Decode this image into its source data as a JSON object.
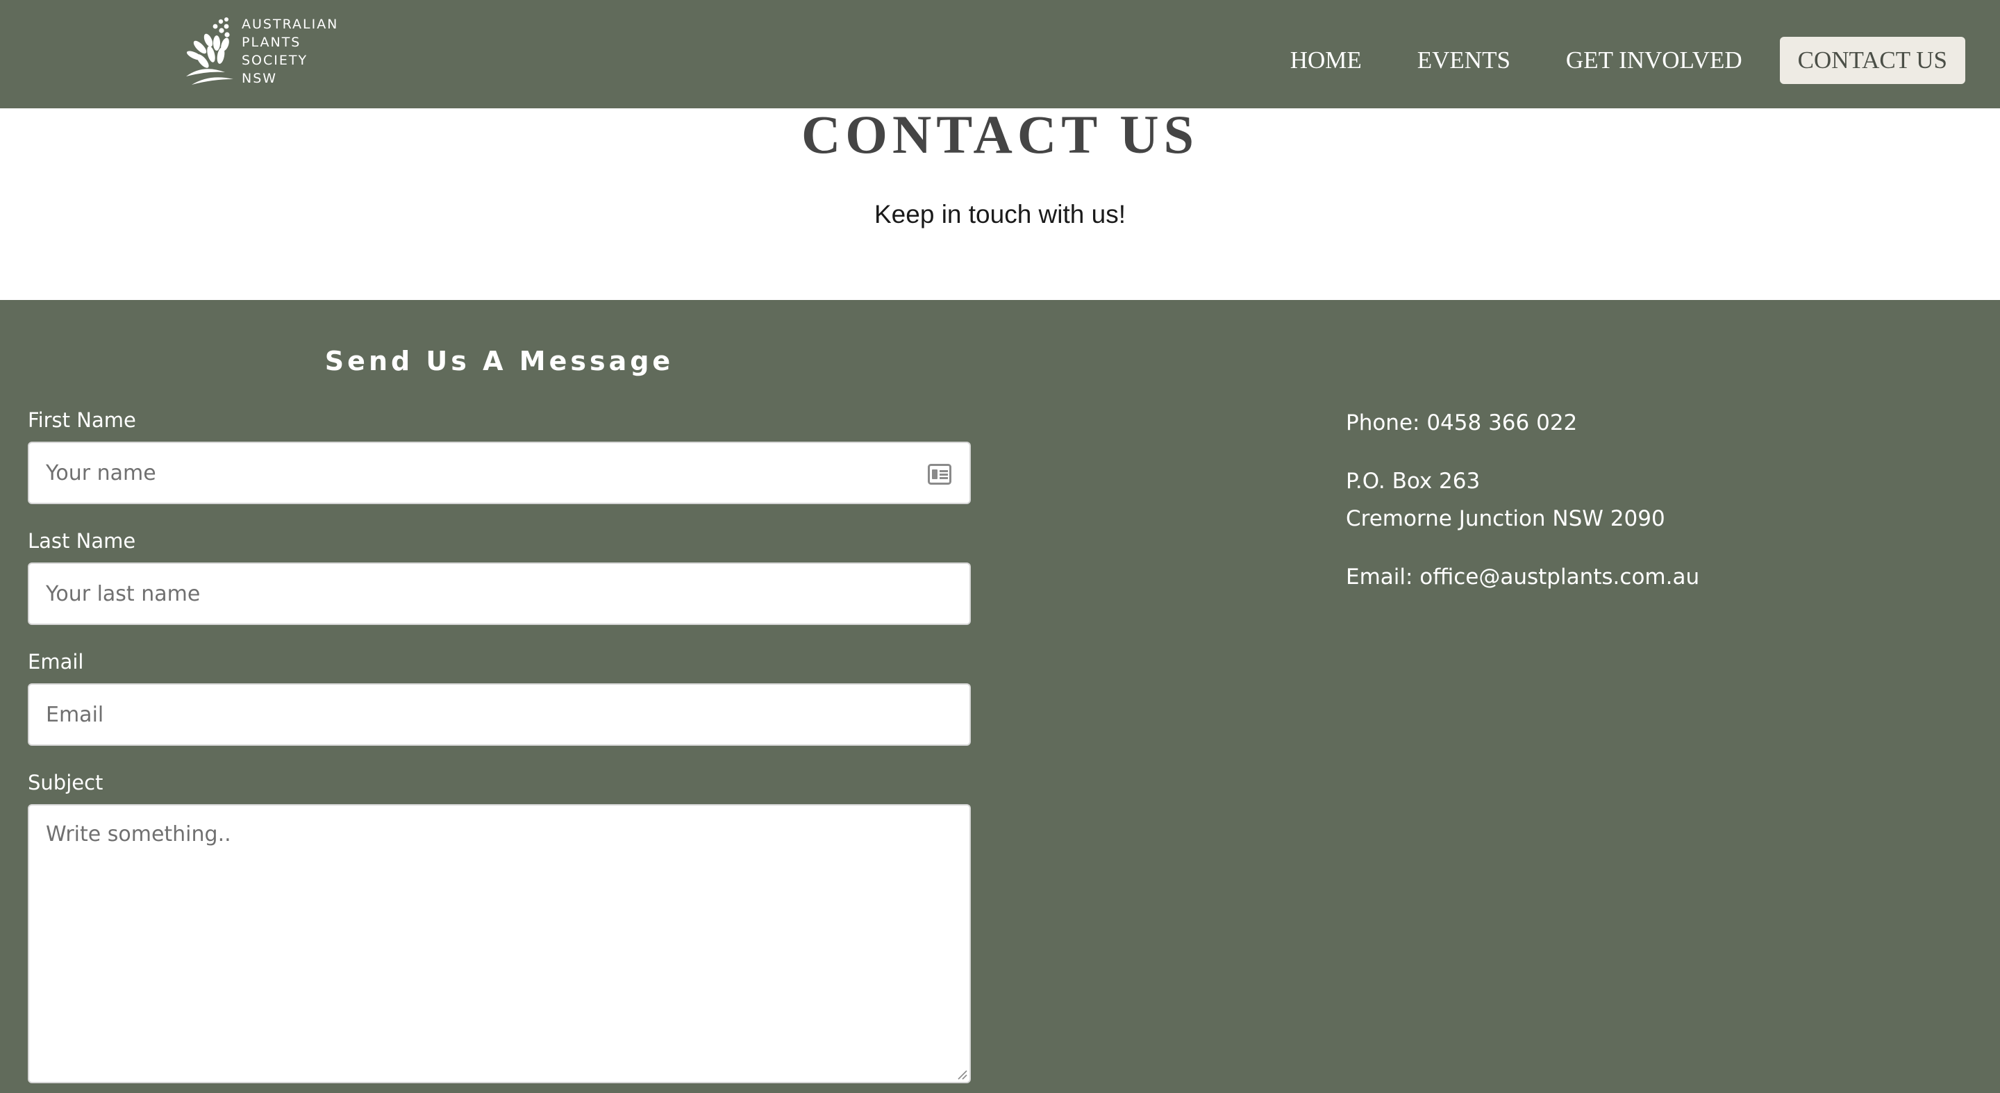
{
  "header": {
    "logo": {
      "line1": "AUSTRALIAN",
      "line2": "PLANTS",
      "line3": "SOCIETY",
      "line4": "NSW"
    },
    "nav": {
      "home": "HOME",
      "events": "EVENTS",
      "get_involved": "GET INVOLVED",
      "contact": "CONTACT US"
    },
    "bg_color": "#616b5b"
  },
  "hero": {
    "title": "CONTACT US",
    "subtitle": "Keep in touch with us!"
  },
  "form": {
    "title": "Send Us A Message",
    "first_name": {
      "label": "First Name",
      "placeholder": "Your name",
      "icon": "contact-card-icon"
    },
    "last_name": {
      "label": "Last Name",
      "placeholder": "Your last name"
    },
    "email": {
      "label": "Email",
      "placeholder": "Email"
    },
    "subject": {
      "label": "Subject",
      "placeholder": "Write something.."
    }
  },
  "contact": {
    "phone": "Phone: 0458 366 022",
    "address_line1": "P.O. Box 263",
    "address_line2": "Cremorne Junction NSW 2090",
    "email": "Email: office@austplants.com.au"
  },
  "colors": {
    "green": "#616b5b",
    "active_nav_bg": "#eeebe4"
  }
}
